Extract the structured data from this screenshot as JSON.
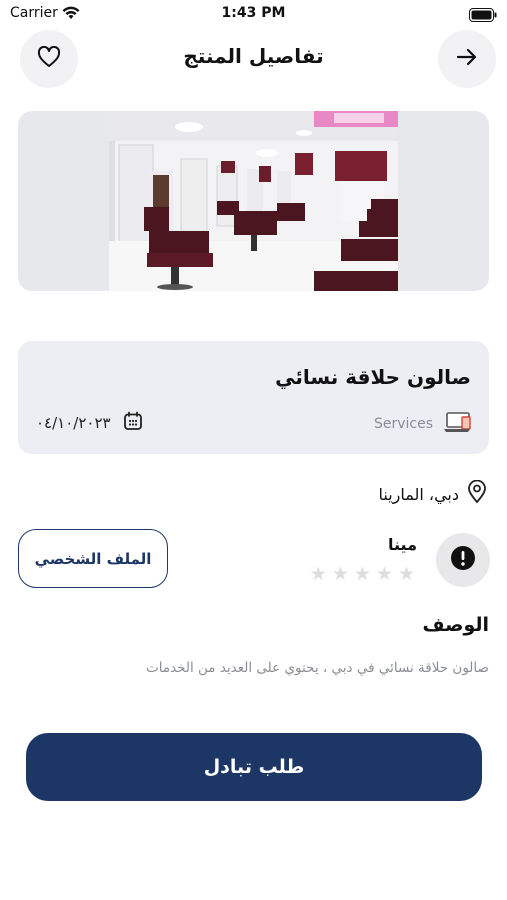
{
  "status_bar": {
    "carrier": "Carrier",
    "time": "1:43 PM"
  },
  "header": {
    "title": "تفاصيل المنتج",
    "favorite_icon": "heart-icon",
    "back_icon": "arrow-right-icon"
  },
  "banner": {
    "image": "salon-interior-photo"
  },
  "product": {
    "name": "صالون حلاقة نسائي",
    "category": "Services",
    "category_icon": "laptop-icon",
    "date": "٠٤/١٠/٢٠٢٣",
    "date_icon": "calendar-icon"
  },
  "location": {
    "text": "دبي، المارينا",
    "icon": "location-pin-icon"
  },
  "owner": {
    "name": "مينا",
    "rating_stars": 5,
    "rating_filled": 0,
    "avatar_icon": "alert-icon"
  },
  "profile_button": {
    "label": "الملف الشخصي"
  },
  "description": {
    "heading": "الوصف",
    "text": "صالون حلاقة نسائي في دبي ، يحتوي على العديد من الخدمات"
  },
  "cta": {
    "label": "طلب تبادل"
  },
  "colors": {
    "primary": "#1c3766",
    "card_bg": "#eceef3",
    "muted_text": "#8a8d94"
  }
}
